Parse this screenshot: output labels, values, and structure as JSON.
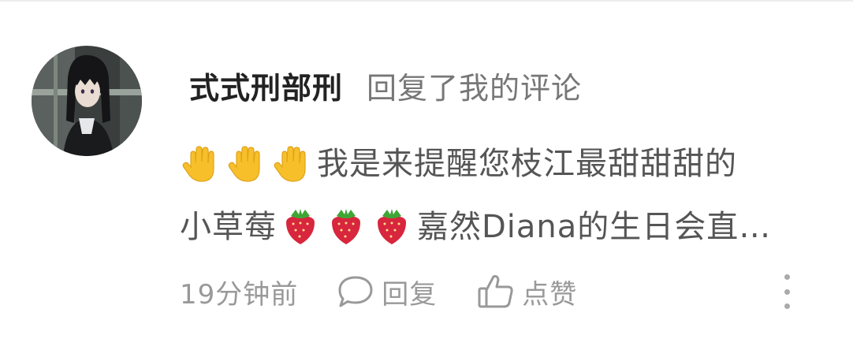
{
  "notification": {
    "username": "式式刑部刑",
    "action_text": "回复了我的评论",
    "comment_line1_text": "我是来提醒您枝江最甜甜甜的",
    "comment_line2_prefix": "小草莓",
    "comment_line2_suffix": "嘉然Diana的生日会直…",
    "line1_emoji": [
      "raised-hand",
      "raised-hand",
      "raised-hand"
    ],
    "line2_emoji": [
      "strawberry",
      "strawberry",
      "strawberry"
    ],
    "timestamp": "19分钟前",
    "reply_label": "回复",
    "like_label": "点赞"
  },
  "icons": {
    "reply": "speech-bubble-icon",
    "like": "thumbs-up-icon",
    "more": "vertical-ellipsis-icon"
  },
  "colors": {
    "username": "#222222",
    "action": "#777777",
    "comment": "#555555",
    "meta": "#999999",
    "hand_emoji": "#f7c02b",
    "strawberry_emoji": "#d7263d"
  }
}
